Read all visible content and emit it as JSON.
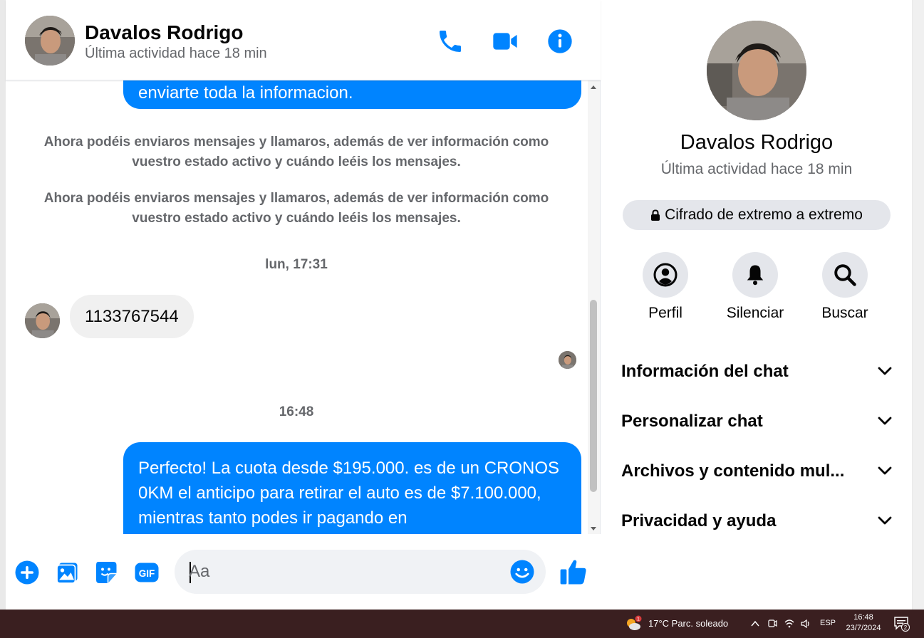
{
  "contact": {
    "name": "Davalos Rodrigo",
    "status": "Última actividad hace 18 min"
  },
  "header": {
    "icons": [
      "phone-icon",
      "video-icon",
      "info-icon"
    ]
  },
  "messages": {
    "outgoing_1": "enviarte toda la informacion.",
    "system_1": "Ahora podéis enviaros mensajes y llamaros, además de ver información como vuestro estado activo y cuándo leéis los mensajes.",
    "system_2": "Ahora podéis enviaros mensajes y llamaros, además de ver información como vuestro estado activo y cuándo leéis los mensajes.",
    "timestamp_1": "lun, 17:31",
    "incoming_1": "1133767544",
    "timestamp_2": "16:48",
    "outgoing_2": "Perfecto! La cuota desde $195.000. es de un CRONOS 0KM el anticipo para retirar el auto es de $7.100.000, mientras tanto podes ir pagando en"
  },
  "composer": {
    "placeholder": "Aa",
    "icons": [
      "plus-icon",
      "photo-icon",
      "sticker-icon",
      "gif-icon",
      "emoji-icon",
      "like-icon"
    ],
    "gif_label": "GIF"
  },
  "info_panel": {
    "encryption": "Cifrado de extremo a extremo",
    "actions": [
      {
        "label": "Perfil",
        "icon": "profile-icon"
      },
      {
        "label": "Silenciar",
        "icon": "bell-icon"
      },
      {
        "label": "Buscar",
        "icon": "search-icon"
      }
    ],
    "sections": [
      "Información del chat",
      "Personalizar chat",
      "Archivos y contenido mul...",
      "Privacidad y ayuda"
    ]
  },
  "taskbar": {
    "weather": "17°C  Parc. soleado",
    "weather_badge": "1",
    "language": "ESP",
    "time": "16:48",
    "date": "23/7/2024",
    "notifications": "2"
  },
  "colors": {
    "accent": "#0084ff",
    "incoming_bubble": "#f0f0f0",
    "muted_text": "#65676b",
    "taskbar": "#3a1f20"
  }
}
